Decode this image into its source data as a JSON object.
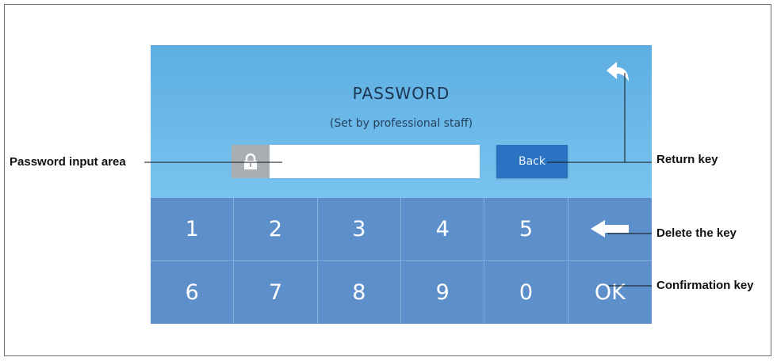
{
  "screen": {
    "title": "PASSWORD",
    "subtitle": "(Set by professional staff)",
    "password_value": "",
    "back_label": "Back",
    "return_icon": "return-arrow-icon",
    "lock_icon": "lock-icon",
    "keys": [
      {
        "label": "1"
      },
      {
        "label": "2"
      },
      {
        "label": "3"
      },
      {
        "label": "4"
      },
      {
        "label": "5"
      },
      {
        "label": ""
      },
      {
        "label": "6"
      },
      {
        "label": "7"
      },
      {
        "label": "8"
      },
      {
        "label": "9"
      },
      {
        "label": "0"
      },
      {
        "label": "OK"
      }
    ],
    "delete_icon": "left-arrow-icon"
  },
  "callouts": {
    "password_input_area": "Password input area",
    "return_key": "Return key",
    "delete_key": "Delete the key",
    "confirmation_key": "Confirmation key"
  },
  "colors": {
    "screen_top": "#5eaee3",
    "screen_bottom": "#b6e0f6",
    "keypad": "#5d90cb",
    "back_button": "#2c72c3",
    "lock_box": "#a9aeb3"
  }
}
